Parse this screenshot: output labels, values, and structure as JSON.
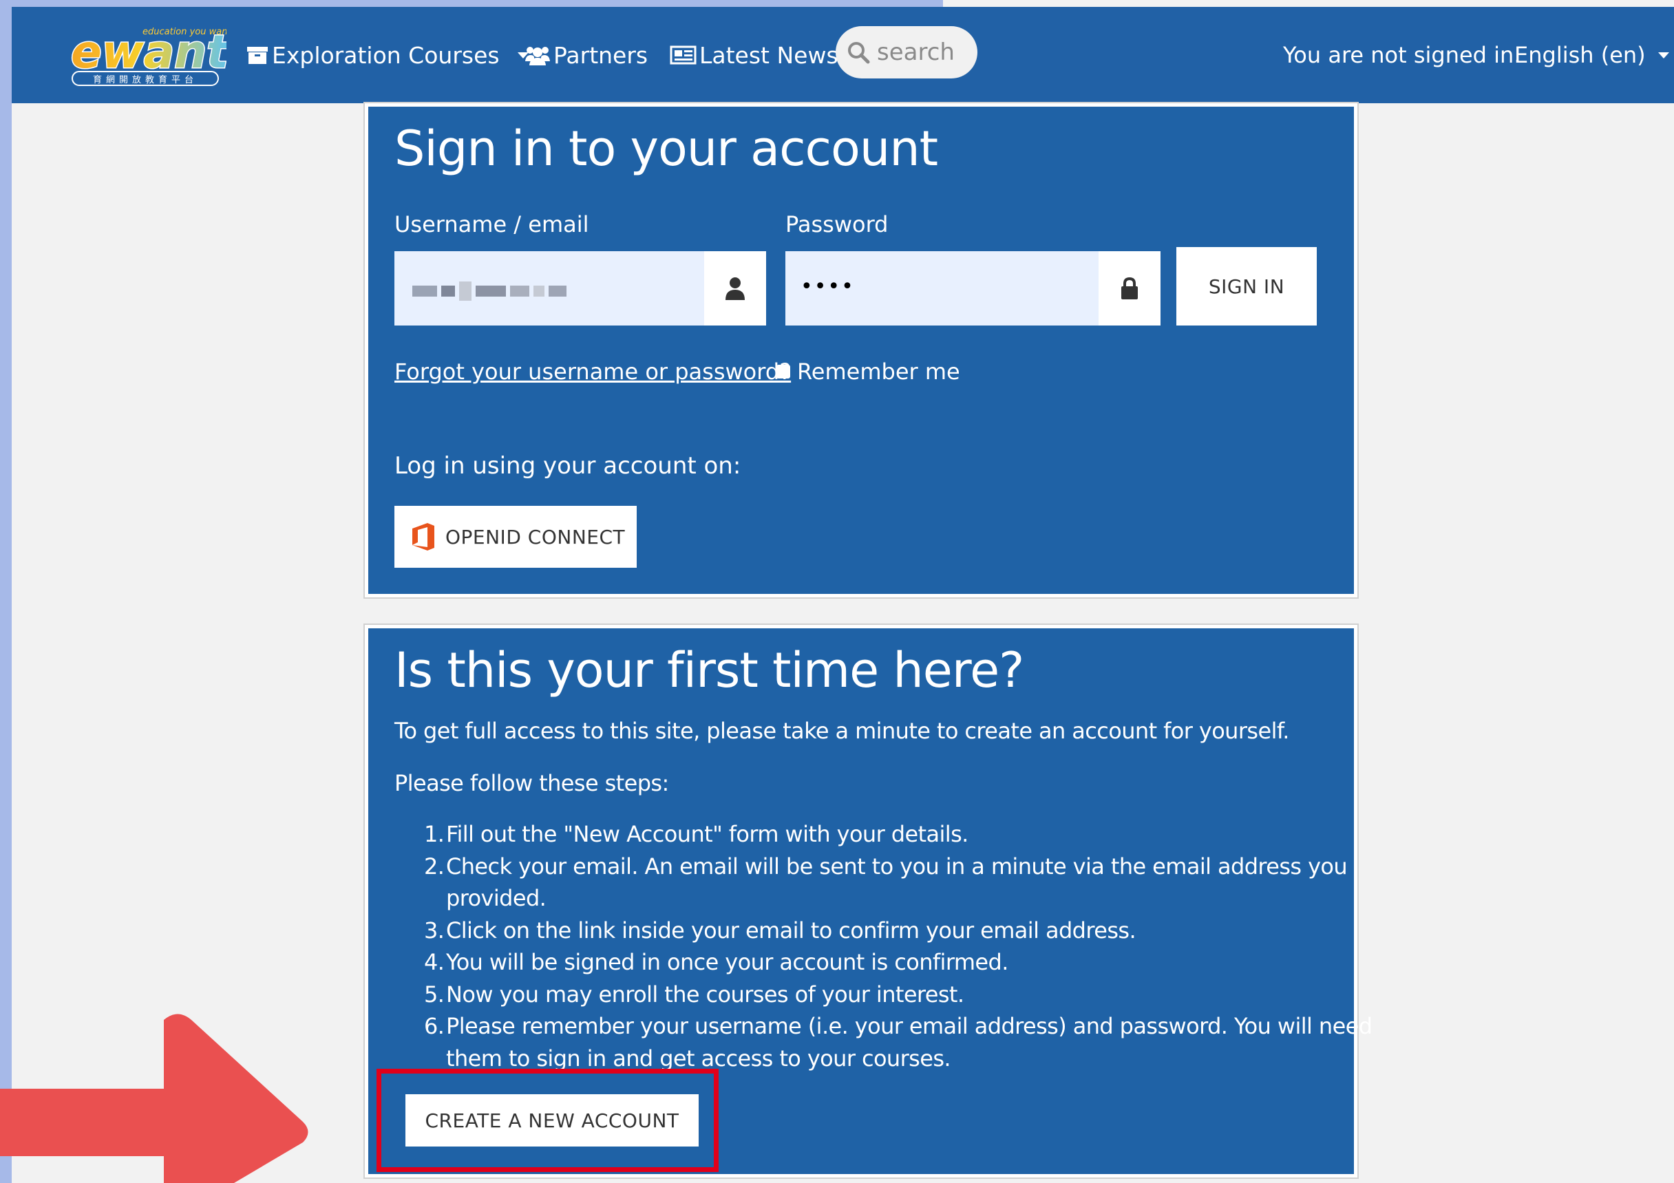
{
  "brand": {
    "logo_text": "ewant",
    "logo_tagline": "education you want",
    "logo_subtitle": "育網開放教育平台"
  },
  "nav": {
    "items": [
      {
        "label": "Exploration Courses",
        "icon": "box-icon",
        "has_dropdown": true
      },
      {
        "label": "Partners",
        "icon": "users-icon",
        "has_dropdown": false
      },
      {
        "label": "Latest News",
        "icon": "newspaper-icon",
        "has_dropdown": false
      }
    ],
    "search_placeholder": "search",
    "signin_status": "You are not signed in.",
    "language": "English (en)"
  },
  "login": {
    "title": "Sign in to your account",
    "username_label": "Username / email",
    "username_value": "",
    "password_label": "Password",
    "password_value": "••••",
    "signin_button": "SIGN IN",
    "forgot_link": "Forgot your username or password?",
    "remember_label": "Remember me",
    "alt_login_heading": "Log in using your account on:",
    "openid_button": "OPENID CONNECT"
  },
  "signup": {
    "title": "Is this your first time here?",
    "intro": "To get full access to this site, please take a minute to create an account for yourself.",
    "steps_heading": "Please follow these steps:",
    "steps": [
      "Fill out the \"New Account\" form with your details.",
      "Check your email. An email will be sent to you in a minute via the email address you",
      "provided.",
      "Click on the link inside your email to confirm your email address.",
      "You will be signed in once your account is confirmed.",
      "Now you may enroll the courses of your interest.",
      "Please remember your username (i.e. your email address) and password. You will need",
      "them to sign in and get access to your courses."
    ],
    "step_numbers": [
      "1.",
      "2.",
      "",
      "3.",
      "4.",
      "5.",
      "6.",
      ""
    ],
    "create_button": "CREATE A NEW ACCOUNT"
  },
  "colors": {
    "navbar": "#2161a6",
    "card": "#1f62a6",
    "highlight_box": "#e1001a",
    "arrow": "#ea5050"
  }
}
